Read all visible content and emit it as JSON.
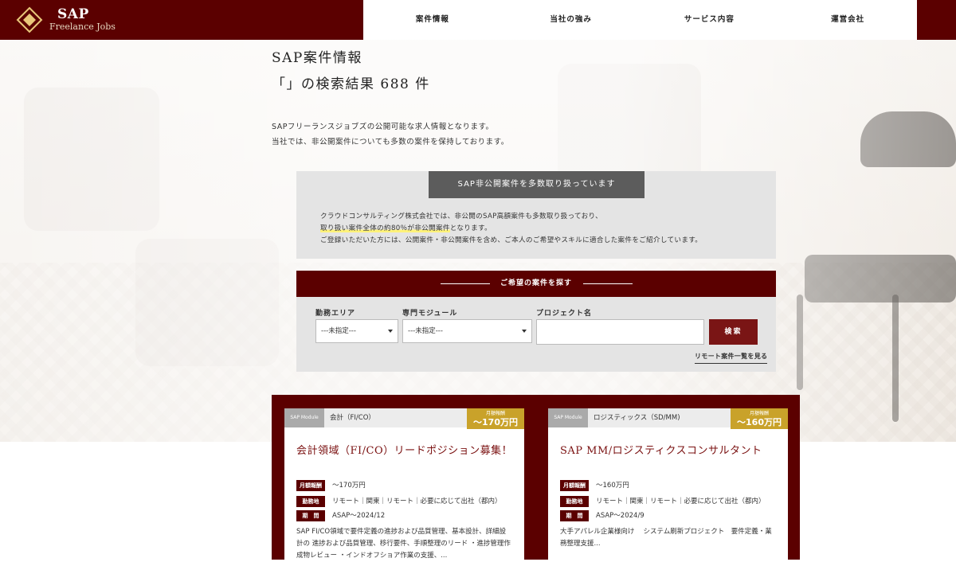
{
  "header": {
    "logo_main": "SAP",
    "logo_sub": "Freelance Jobs",
    "nav": [
      "案件情報",
      "当社の強み",
      "サービス内容",
      "運営会社"
    ]
  },
  "page": {
    "title": "SAP案件情報",
    "result_line": "「」の検索結果 688 件",
    "intro_line1": "SAPフリーランスジョブズの公開可能な求人情報となります。",
    "intro_line2": "当社では、非公開案件についても多数の案件を保持しております。"
  },
  "private": {
    "heading": "SAP非公開案件を多数取り扱っています",
    "line1": "クラウドコンサルティング株式会社では、非公開のSAP高額案件も多数取り扱っており、",
    "line2_highlight": "取り扱い案件全体の約80％が非公開案件",
    "line2_rest": "となります。",
    "line3": "ご登録いただいた方には、公開案件・非公開案件を含め、ご本人のご希望やスキルに適合した案件をご紹介しています。"
  },
  "search": {
    "heading": "ご希望の案件を探す",
    "area_label": "勤務エリア",
    "area_value": "---未指定---",
    "module_label": "専門モジュール",
    "module_value": "---未指定---",
    "project_label": "プロジェクト名",
    "project_value": "",
    "button": "検索",
    "remote_link": "リモート案件一覧を見る"
  },
  "cards": [
    {
      "module_tag": "SAP Module",
      "module": "会計（FI/CO）",
      "price_label": "月額報酬",
      "price": "〜170万円",
      "title": "会計領域（FI/CO）リードポジション募集！",
      "rows": [
        {
          "tag": "月額報酬",
          "value": "〜170万円"
        },
        {
          "tag": "勤務地",
          "value": "リモート｜関東｜リモート｜必要に応じて出社（都内）"
        },
        {
          "tag": "期　間",
          "value": "ASAP〜2024/12"
        }
      ],
      "desc1": "SAP FI/CO領域で要件定義の進捗および品質管理、基本設計、詳細設",
      "desc2": "計の 進捗および品質管理、移行要件、手順整理のリード ・進捗管理作",
      "desc3": "成物レビュー ・インドオフショア作業の支援、..."
    },
    {
      "module_tag": "SAP Module",
      "module": "ロジスティックス（SD/MM)",
      "price_label": "月額報酬",
      "price": "〜160万円",
      "title": "SAP MM/ロジスティクスコンサルタント",
      "rows": [
        {
          "tag": "月額報酬",
          "value": "〜160万円"
        },
        {
          "tag": "勤務地",
          "value": "リモート｜関東｜リモート｜必要に応じて出社（都内）"
        },
        {
          "tag": "期　間",
          "value": "ASAP〜2024/9"
        }
      ],
      "desc1": "大手アパレル企業様向け　 システム刷新プロジェクト　要件定義・業",
      "desc2": "務整理支援...",
      "desc3": ""
    }
  ],
  "colors": {
    "brand": "#5b0000",
    "accent_gold": "#c9a22a",
    "title_red": "#7a1010"
  }
}
